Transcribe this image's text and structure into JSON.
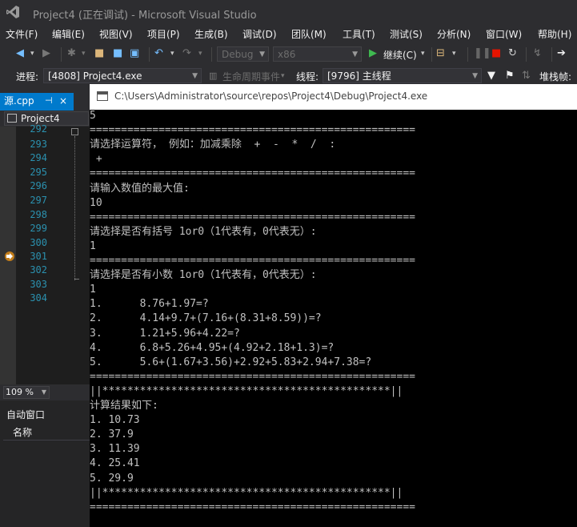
{
  "window": {
    "title": "Project4 (正在调试) - Microsoft Visual Studio"
  },
  "menu": [
    "文件(F)",
    "编辑(E)",
    "视图(V)",
    "项目(P)",
    "生成(B)",
    "调试(D)",
    "团队(M)",
    "工具(T)",
    "测试(S)",
    "分析(N)",
    "窗口(W)",
    "帮助(H)"
  ],
  "toolbar": {
    "config": "Debug",
    "platform": "x86",
    "continue_label": "继续(C)"
  },
  "debugbar": {
    "process_label": "进程:",
    "process_value": "[4808] Project4.exe",
    "lifecycle_label": "生命周期事件",
    "thread_label": "线程:",
    "thread_value": "[9796] 主线程",
    "stackframe_label": "堆栈帧:"
  },
  "editor": {
    "tab_name": "源.cpp",
    "pin_glyph": "⊣",
    "close_glyph": "×",
    "nav_project": "Project4",
    "line_numbers": [
      "292",
      "293",
      "294",
      "295",
      "296",
      "297",
      "298",
      "299",
      "300",
      "301",
      "302",
      "303",
      "304"
    ],
    "zoom": "109 %"
  },
  "autos": {
    "title": "自动窗口",
    "column_name": "名称"
  },
  "console": {
    "title": "C:\\Users\\Administrator\\source\\repos\\Project4\\Debug\\Project4.exe",
    "lines": [
      "5",
      "====================================================",
      "请选择运算符， 例如：加减乘除  +  -  *  /  :",
      " +",
      "====================================================",
      "请输入数值的最大值:",
      "10",
      "====================================================",
      "请选择是否有括号 1or0（1代表有，0代表无）:",
      "1",
      "====================================================",
      "请选择是否有小数 1or0（1代表有，0代表无）:",
      "1",
      "1.      8.76+1.97=?",
      "2.      4.14+9.7+(7.16+(8.31+8.59))=?",
      "3.      1.21+5.96+4.22=?",
      "4.      6.8+5.26+4.95+(4.92+2.18+1.3)=?",
      "5.      5.6+(1.67+3.56)+2.92+5.83+2.94+7.38=?",
      "====================================================",
      "||**********************************************||",
      "计算结果如下:",
      "1. 10.73",
      "2. 37.9",
      "3. 11.39",
      "4. 25.41",
      "5. 29.9",
      "||**********************************************||",
      "===================================================="
    ]
  },
  "colors": {
    "accent": "#007acc",
    "chrome": "#2d2d30",
    "line_number": "#2b91af"
  }
}
